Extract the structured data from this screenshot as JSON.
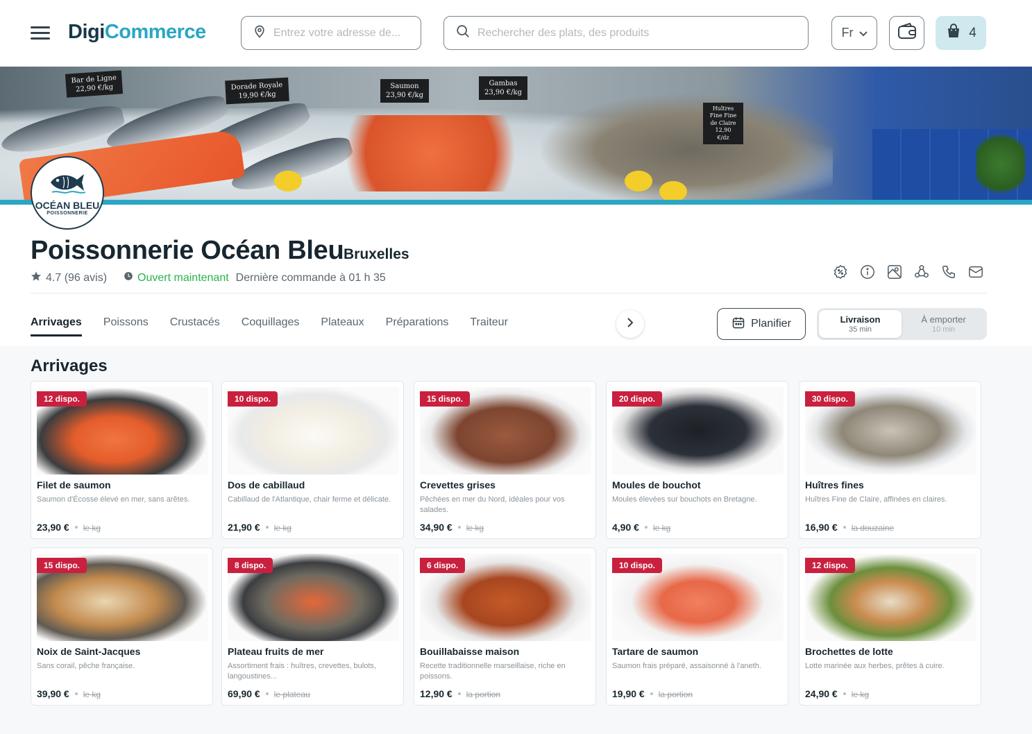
{
  "header": {
    "logo_part1": "Digi",
    "logo_part2": "Commerce",
    "address_placeholder": "Entrez votre adresse de...",
    "search_placeholder": "Rechercher des plats, des produits",
    "language": "Fr",
    "cart_count": "4"
  },
  "banner": {
    "price_tags": [
      {
        "name": "Bar de Ligne",
        "price": "22,90 €/kg"
      },
      {
        "name": "Dorade Royale",
        "price": "19,90 €/kg"
      },
      {
        "name": "Saumon",
        "price": "23,90 €/kg"
      },
      {
        "name": "Gambas",
        "price": "23,90 €/kg"
      },
      {
        "name": "Huîtres Fine Fine de Claire",
        "price": "12,90 €/dz"
      }
    ],
    "brand_line1": "OCÉAN BLEU",
    "brand_line2": "POISSONNERIE"
  },
  "shop": {
    "name": "Poissonnerie Océan Bleu",
    "city": "Bruxelles",
    "rating": "4.7 (96 avis)",
    "status": "Ouvert maintenant",
    "last_order": "Dernière commande à 01 h 35"
  },
  "tabs": [
    "Arrivages",
    "Poissons",
    "Crustacés",
    "Coquillages",
    "Plateaux",
    "Préparations",
    "Traiteur"
  ],
  "actions": {
    "plan_label": "Planifier",
    "delivery_label": "Livraison",
    "delivery_time": "35 min",
    "pickup_label": "À emporter",
    "pickup_time": "10 min"
  },
  "section": {
    "title": "Arrivages"
  },
  "products": [
    {
      "stock": "12 dispo.",
      "name": "Filet de saumon",
      "desc": "Saumon d'Écosse élevé en mer, sans arêtes.",
      "price": "23,90 €",
      "unit": "le kg"
    },
    {
      "stock": "10 dispo.",
      "name": "Dos de cabillaud",
      "desc": "Cabillaud de l'Atlantique, chair ferme et délicate.",
      "price": "21,90 €",
      "unit": "le kg"
    },
    {
      "stock": "15 dispo.",
      "name": "Crevettes grises",
      "desc": "Pêchées en mer du Nord, idéales pour vos salades.",
      "price": "34,90 €",
      "unit": "le kg"
    },
    {
      "stock": "20 dispo.",
      "name": "Moules de bouchot",
      "desc": "Moules élevées sur bouchots en Bretagne.",
      "price": "4,90 €",
      "unit": "le kg"
    },
    {
      "stock": "30 dispo.",
      "name": "Huîtres fines",
      "desc": "Huîtres Fine de Claire, affinées en claires.",
      "price": "16,90 €",
      "unit": "la douzaine"
    },
    {
      "stock": "15 dispo.",
      "name": "Noix de Saint-Jacques",
      "desc": "Sans corail, pêche française.",
      "price": "39,90 €",
      "unit": "le kg"
    },
    {
      "stock": "8 dispo.",
      "name": "Plateau fruits de mer",
      "desc": "Assortiment frais : huîtres, crevettes, bulots, langoustines...",
      "price": "69,90 €",
      "unit": "le plateau"
    },
    {
      "stock": "6 dispo.",
      "name": "Bouillabaisse maison",
      "desc": "Recette traditionnelle marseillaise, riche en poissons.",
      "price": "12,90 €",
      "unit": "la portion"
    },
    {
      "stock": "10 dispo.",
      "name": "Tartare de saumon",
      "desc": "Saumon frais préparé, assaisonné à l'aneth.",
      "price": "19,90 €",
      "unit": "la portion"
    },
    {
      "stock": "12 dispo.",
      "name": "Brochettes de lotte",
      "desc": "Lotte marinée aux herbes, prêtes à cuire.",
      "price": "24,90 €",
      "unit": "le kg"
    }
  ],
  "colors": {
    "brand_dark": "#17384a",
    "brand_teal": "#2aa6c4",
    "badge_red": "#c8203e",
    "open_green": "#2bb34a"
  },
  "icons": [
    "menu-icon",
    "location-pin-icon",
    "search-icon",
    "chevron-down-icon",
    "wallet-icon",
    "shopping-bag-icon",
    "star-icon",
    "clock-icon",
    "discount-badge-icon",
    "info-icon",
    "map-icon",
    "share-icon",
    "phone-icon",
    "mail-icon",
    "chevron-right-icon",
    "calendar-icon"
  ]
}
